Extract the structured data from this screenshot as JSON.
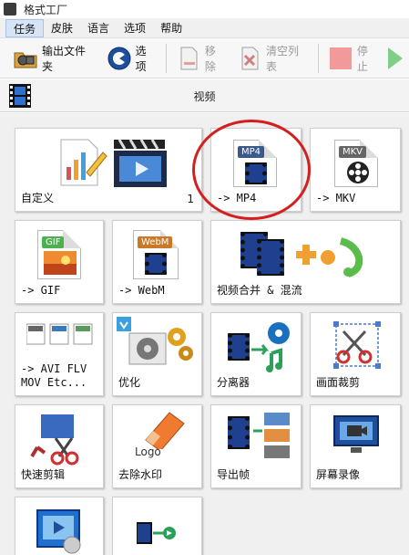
{
  "window": {
    "title": "格式工厂"
  },
  "menu": {
    "items": [
      "任务",
      "皮肤",
      "语言",
      "选项",
      "帮助"
    ]
  },
  "toolbar": {
    "output_folder": "输出文件夹",
    "options": "选项",
    "remove": "移除",
    "clear_list": "清空列表",
    "stop": "停止"
  },
  "section": {
    "title": "视频"
  },
  "tiles": {
    "custom": {
      "label": "自定义",
      "count": "1"
    },
    "mp4": {
      "label": "-> MP4",
      "badge": "MP4"
    },
    "mkv": {
      "label": "-> MKV",
      "badge": "MKV"
    },
    "gif": {
      "label": "-> GIF",
      "badge": "GIF"
    },
    "webm": {
      "label": "-> WebM",
      "badge": "WebM"
    },
    "merge": {
      "label": "视频合并 & 混流"
    },
    "avi": {
      "label": "-> AVI FLV\nMOV Etc..."
    },
    "optimize": {
      "label": "优化"
    },
    "splitter": {
      "label": "分离器"
    },
    "crop": {
      "label": "画面裁剪"
    },
    "quick_cut": {
      "label": "快速剪辑"
    },
    "watermark": {
      "label": "去除水印",
      "logo_text": "Logo"
    },
    "export_frames": {
      "label": "导出帧"
    },
    "screen_record": {
      "label": "屏幕录像"
    }
  }
}
